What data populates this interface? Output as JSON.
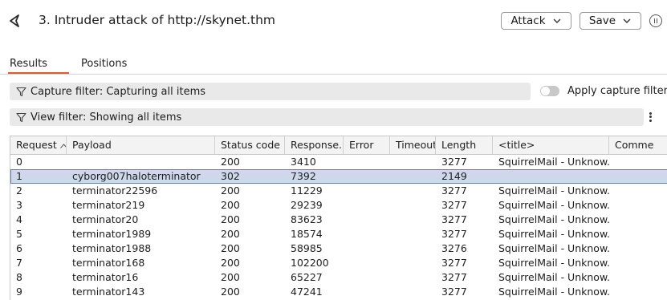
{
  "header": {
    "title": "3. Intruder attack of http://skynet.thm",
    "attack_label": "Attack",
    "save_label": "Save"
  },
  "tabs": [
    {
      "label": "Results",
      "active": true
    },
    {
      "label": "Positions",
      "active": false
    }
  ],
  "filters": {
    "capture": "Capture filter: Capturing all items",
    "view": "View filter: Showing all items",
    "apply_capture_label": "Apply capture filter",
    "apply_capture_on": false
  },
  "table": {
    "columns": [
      "Request",
      "Payload",
      "Status code",
      "Response...",
      "Error",
      "Timeout",
      "Length",
      "<title>",
      "Comme"
    ],
    "rows": [
      {
        "request": "0",
        "payload": "",
        "status": "200",
        "response": "3410",
        "error": "",
        "timeout": "",
        "length": "3277",
        "title": "SquirrelMail - Unknow...",
        "comment": ""
      },
      {
        "request": "1",
        "payload": "cyborg007haloterminator",
        "status": "302",
        "response": "7392",
        "error": "",
        "timeout": "",
        "length": "2149",
        "title": "",
        "comment": "",
        "selected": true
      },
      {
        "request": "2",
        "payload": "terminator22596",
        "status": "200",
        "response": "11229",
        "error": "",
        "timeout": "",
        "length": "3277",
        "title": "SquirrelMail - Unknow...",
        "comment": ""
      },
      {
        "request": "3",
        "payload": "terminator219",
        "status": "200",
        "response": "29239",
        "error": "",
        "timeout": "",
        "length": "3277",
        "title": "SquirrelMail - Unknow...",
        "comment": ""
      },
      {
        "request": "4",
        "payload": "terminator20",
        "status": "200",
        "response": "83623",
        "error": "",
        "timeout": "",
        "length": "3277",
        "title": "SquirrelMail - Unknow...",
        "comment": ""
      },
      {
        "request": "5",
        "payload": "terminator1989",
        "status": "200",
        "response": "18574",
        "error": "",
        "timeout": "",
        "length": "3277",
        "title": "SquirrelMail - Unknow...",
        "comment": ""
      },
      {
        "request": "6",
        "payload": "terminator1988",
        "status": "200",
        "response": "58985",
        "error": "",
        "timeout": "",
        "length": "3276",
        "title": "SquirrelMail - Unknow...",
        "comment": ""
      },
      {
        "request": "7",
        "payload": "terminator168",
        "status": "200",
        "response": "102200",
        "error": "",
        "timeout": "",
        "length": "3277",
        "title": "SquirrelMail - Unknow...",
        "comment": ""
      },
      {
        "request": "8",
        "payload": "terminator16",
        "status": "200",
        "response": "65227",
        "error": "",
        "timeout": "",
        "length": "3277",
        "title": "SquirrelMail - Unknow...",
        "comment": ""
      },
      {
        "request": "9",
        "payload": "terminator143",
        "status": "200",
        "response": "47241",
        "error": "",
        "timeout": "",
        "length": "3277",
        "title": "SquirrelMail - Unknow...",
        "comment": ""
      }
    ]
  },
  "colors": {
    "accent": "#e35a2b",
    "selected_row": "#cfd8ea",
    "filter_bg": "#e9e9e9"
  }
}
